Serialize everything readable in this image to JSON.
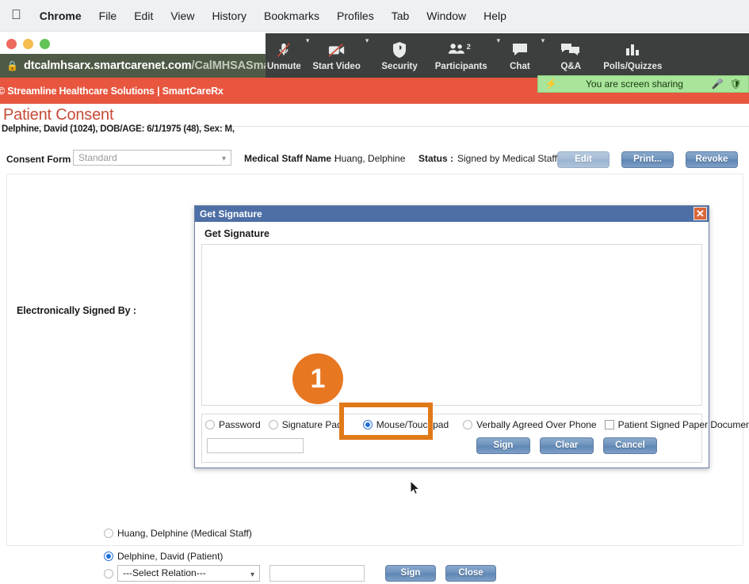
{
  "macbar": {
    "apple_icon": "apple-icon",
    "items": [
      {
        "label": "Chrome",
        "bold": true
      },
      {
        "label": "File",
        "bold": false
      },
      {
        "label": "Edit",
        "bold": false
      },
      {
        "label": "View",
        "bold": false
      },
      {
        "label": "History",
        "bold": false
      },
      {
        "label": "Bookmarks",
        "bold": false
      },
      {
        "label": "Profiles",
        "bold": false
      },
      {
        "label": "Tab",
        "bold": false
      },
      {
        "label": "Window",
        "bold": false
      },
      {
        "label": "Help",
        "bold": false
      }
    ]
  },
  "browser": {
    "lock_icon": "lock-icon",
    "url_strong": "dtcalmhsarx.smartcarenet.com",
    "url_dim": "/CalMHSASmar"
  },
  "app_banner": {
    "text": "© Streamline Healthcare Solutions | SmartCareRx",
    "color": "#e8563f"
  },
  "zoom_toolbar": {
    "background": "#3c3f3e",
    "items": [
      {
        "label": "Unmute",
        "icon": "microphone-muted-icon",
        "caret": true
      },
      {
        "label": "Start Video",
        "icon": "video-off-icon",
        "caret": true
      },
      {
        "label": "Security",
        "icon": "shield-icon",
        "caret": false
      },
      {
        "label": "Participants",
        "icon": "participants-icon",
        "caret": true,
        "badge": "2"
      },
      {
        "label": "Chat",
        "icon": "chat-bubble-icon",
        "caret": true
      },
      {
        "label": "Q&A",
        "icon": "qa-bubbles-icon",
        "caret": false
      },
      {
        "label": "Polls/Quizzes",
        "icon": "bar-chart-icon",
        "caret": false
      }
    ]
  },
  "share_banner": {
    "bolt_icon": "bolt-icon",
    "text": "You are screen sharing",
    "mic_icon": "mic-muted-icon",
    "shield_icon": "shield-check-icon",
    "color": "#a8e49a"
  },
  "page": {
    "title": "Patient Consent",
    "title_color": "#c64a36",
    "patient_line": "Delphine, David (1024), DOB/AGE: 6/1/1975 (48), Sex: M,",
    "consent_form_label": "Consent Form :",
    "consent_form_value": "Standard",
    "medical_staff_label": "Medical Staff Name :",
    "medical_staff_value": "Huang, Delphine",
    "status_label": "Status :",
    "status_value": "Signed by Medical Staff",
    "buttons": {
      "edit": "Edit",
      "print": "Print...",
      "revoke": "Revoke"
    },
    "electronically_signed_by": "Electronically Signed By :"
  },
  "modal": {
    "title": "Get Signature",
    "close_icon": "close-icon",
    "heading": "Get Signature",
    "options": [
      {
        "label": "Password",
        "type": "radio",
        "selected": false
      },
      {
        "label": "Signature Pad",
        "type": "radio",
        "selected": false
      },
      {
        "label": "Mouse/Touchpad",
        "type": "radio",
        "selected": true
      },
      {
        "label": "Verbally Agreed Over Phone",
        "type": "radio",
        "selected": false
      },
      {
        "label": "Patient Signed Paper Document",
        "type": "checkbox",
        "selected": false
      }
    ],
    "password_value": "",
    "buttons": {
      "sign": "Sign",
      "clear": "Clear",
      "cancel": "Cancel"
    }
  },
  "annotation": {
    "step_number": "1",
    "accent_color": "#e87722",
    "highlight_color": "#e07a19"
  },
  "signers": {
    "option_staff": "Huang, Delphine (Medical Staff)",
    "option_patient": "Delphine, David (Patient)",
    "relation_value": "---Select Relation---",
    "relation_text_value": "",
    "sign_label": "Sign",
    "close_label": "Close"
  }
}
